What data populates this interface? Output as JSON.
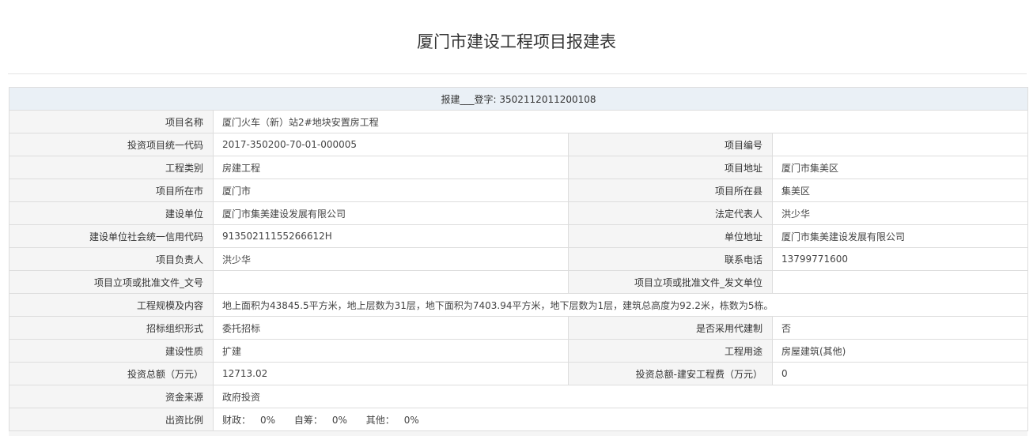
{
  "page": {
    "title": "厦门市建设工程项目报建表"
  },
  "registration": {
    "label": "报建___登字:",
    "number": "3502112011200108"
  },
  "rows": {
    "project_name": {
      "label": "项目名称",
      "value": "厦门火车（新）站2#地块安置房工程"
    },
    "investment_code": {
      "label": "投资项目统一代码",
      "value": "2017-350200-70-01-000005"
    },
    "project_number": {
      "label": "项目编号",
      "value": ""
    },
    "project_category": {
      "label": "工程类别",
      "value": "房建工程"
    },
    "project_address": {
      "label": "项目地址",
      "value": "厦门市集美区"
    },
    "project_city": {
      "label": "项目所在市",
      "value": "厦门市"
    },
    "project_county": {
      "label": "项目所在县",
      "value": "集美区"
    },
    "builder": {
      "label": "建设单位",
      "value": "厦门市集美建设发展有限公司"
    },
    "legal_rep": {
      "label": "法定代表人",
      "value": "洪少华"
    },
    "credit_code": {
      "label": "建设单位社会统一信用代码",
      "value": "91350211155266612H"
    },
    "unit_address": {
      "label": "单位地址",
      "value": "厦门市集美建设发展有限公司"
    },
    "project_leader": {
      "label": "项目负责人",
      "value": "洪少华"
    },
    "phone": {
      "label": "联系电话",
      "value": "13799771600"
    },
    "approval_doc_no": {
      "label": "项目立项或批准文件_文号",
      "value": ""
    },
    "approval_issuer": {
      "label": "项目立项或批准文件_发文单位",
      "value": ""
    },
    "scale": {
      "label": "工程规模及内容",
      "value": "地上面积为43845.5平方米，地上层数为31层，地下面积为7403.94平方米，地下层数为1层，建筑总高度为92.2米，栋数为5栋。"
    },
    "tender_form": {
      "label": "招标组织形式",
      "value": "委托招标"
    },
    "agent_build": {
      "label": "是否采用代建制",
      "value": "否"
    },
    "build_nature": {
      "label": "建设性质",
      "value": "扩建"
    },
    "usage": {
      "label": "工程用途",
      "value": "房屋建筑(其他)"
    },
    "total_investment": {
      "label": "投资总额（万元）",
      "value": "12713.02"
    },
    "construction_fee": {
      "label": "投资总额-建安工程费（万元）",
      "value": "0"
    },
    "fund_source": {
      "label": "资金来源",
      "value": "政府投资"
    },
    "fund_ratio": {
      "label": "出资比例",
      "items": [
        {
          "label": "财政：",
          "value": "0%"
        },
        {
          "label": "自筹：",
          "value": "0%"
        },
        {
          "label": "其他：",
          "value": "0%"
        }
      ]
    }
  }
}
